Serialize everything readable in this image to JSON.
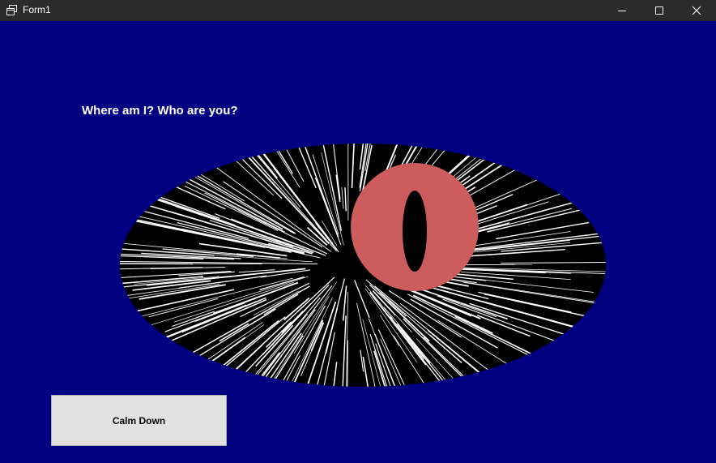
{
  "window": {
    "title": "Form1",
    "controls": {
      "minimize": "minimize-icon",
      "maximize": "maximize-icon",
      "close": "close-icon"
    }
  },
  "content": {
    "speech_text": "Where am I? Who are you?",
    "button_label": "Calm Down"
  },
  "colors": {
    "background": "#000080",
    "titlebar": "#2b2b2b",
    "eye_sclera": "#000000",
    "streaks": "#ffffff",
    "iris": "#cd5c5c",
    "pupil": "#000000",
    "button_face": "#e1e1e1"
  }
}
